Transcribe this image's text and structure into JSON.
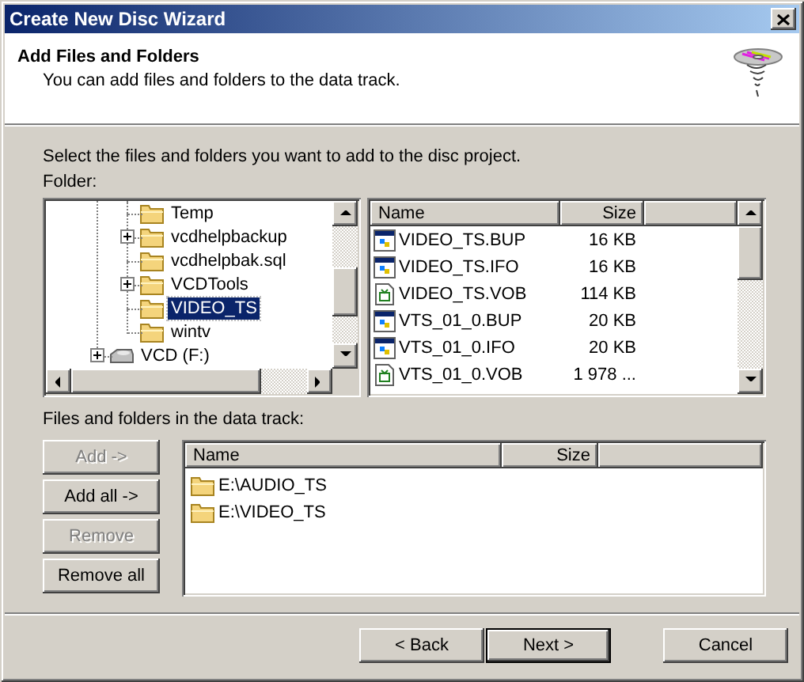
{
  "window": {
    "title": "Create New Disc Wizard"
  },
  "header": {
    "title": "Add Files and Folders",
    "subtitle": "You can add files and folders to the data track."
  },
  "instruction": "Select the files and folders you want to add to the disc project.",
  "folder_label": "Folder:",
  "folder_tree": [
    {
      "kind": "group",
      "children": [
        {
          "label": "Temp",
          "kind": "folder",
          "collapsed": false,
          "selected": false
        },
        {
          "label": "vcdhelpbackup",
          "kind": "folder",
          "collapsed": true,
          "selected": false
        },
        {
          "label": "vcdhelpbak.sql",
          "kind": "folder",
          "collapsed": false,
          "selected": false
        },
        {
          "label": "VCDTools",
          "kind": "folder",
          "collapsed": true,
          "selected": false
        },
        {
          "label": "VIDEO_TS",
          "kind": "folder",
          "collapsed": false,
          "selected": true
        },
        {
          "label": "wintv",
          "kind": "folder",
          "collapsed": false,
          "selected": false
        }
      ]
    },
    {
      "label": "VCD (F:)",
      "kind": "drive",
      "collapsed": true,
      "selected": false
    }
  ],
  "file_list": {
    "columns": [
      "Name",
      "Size"
    ],
    "rows": [
      {
        "name": "VIDEO_TS.BUP",
        "size": "16 KB",
        "kind": "program"
      },
      {
        "name": "VIDEO_TS.IFO",
        "size": "16 KB",
        "kind": "program"
      },
      {
        "name": "VIDEO_TS.VOB",
        "size": "114 KB",
        "kind": "video"
      },
      {
        "name": "VTS_01_0.BUP",
        "size": "20 KB",
        "kind": "program"
      },
      {
        "name": "VTS_01_0.IFO",
        "size": "20 KB",
        "kind": "program"
      },
      {
        "name": "VTS_01_0.VOB",
        "size": "1 978 ...",
        "kind": "video"
      }
    ]
  },
  "data_track": {
    "label": "Files and folders in the data track:",
    "columns": [
      "Name",
      "Size"
    ],
    "rows": [
      {
        "name": "E:\\AUDIO_TS",
        "kind": "folder"
      },
      {
        "name": "E:\\VIDEO_TS",
        "kind": "folder"
      }
    ]
  },
  "side_buttons": [
    {
      "label": "Add ->",
      "disabled": true
    },
    {
      "label": "Add all ->",
      "disabled": false
    },
    {
      "label": "Remove",
      "disabled": true
    },
    {
      "label": "Remove all",
      "disabled": false
    }
  ],
  "nav_buttons": [
    {
      "label": "< Back",
      "default": false
    },
    {
      "label": "Next >",
      "default": true
    },
    {
      "label": "Cancel",
      "default": false
    }
  ]
}
